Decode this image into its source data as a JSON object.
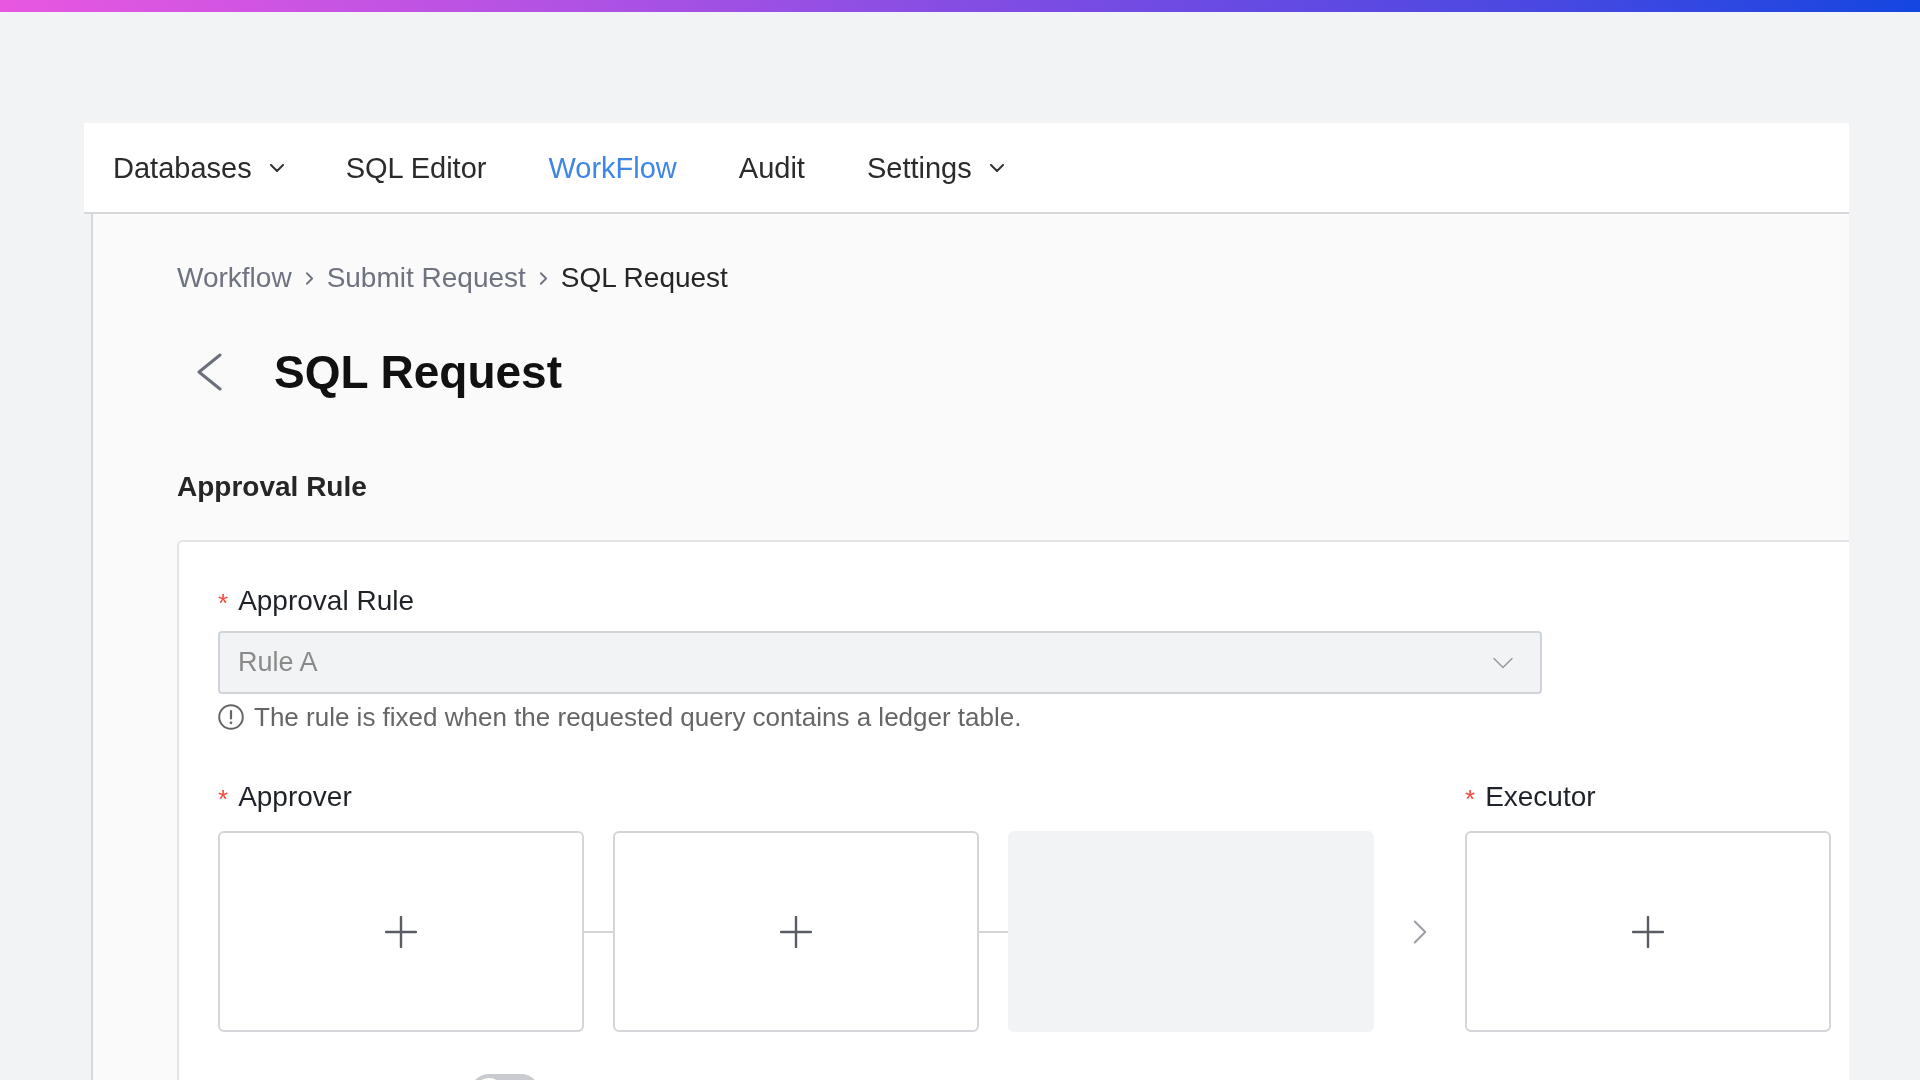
{
  "nav": {
    "items": [
      {
        "label": "Databases",
        "has_menu": true,
        "selected": false
      },
      {
        "label": "SQL Editor",
        "has_menu": false,
        "selected": false
      },
      {
        "label": "WorkFlow",
        "has_menu": false,
        "selected": true
      },
      {
        "label": "Audit",
        "has_menu": false,
        "selected": false
      },
      {
        "label": "Settings",
        "has_menu": true,
        "selected": false
      }
    ]
  },
  "breadcrumb": [
    {
      "label": "Workflow",
      "current": false
    },
    {
      "label": "Submit Request",
      "current": false
    },
    {
      "label": "SQL Request",
      "current": true
    }
  ],
  "page_title": "SQL Request",
  "section_title": "Approval Rule",
  "approval_rule": {
    "required_mark": "*",
    "label": "Approval Rule",
    "value": "Rule A",
    "disabled": true,
    "hint": "The rule is fixed when the requested query contains a ledger table."
  },
  "approver": {
    "required_mark": "*",
    "label": "Approver",
    "slots": [
      {
        "kind": "add"
      },
      {
        "kind": "add"
      },
      {
        "kind": "empty"
      }
    ]
  },
  "executor": {
    "required_mark": "*",
    "label": "Executor",
    "slots": [
      {
        "kind": "add"
      }
    ]
  },
  "toggle": {
    "on": false
  }
}
